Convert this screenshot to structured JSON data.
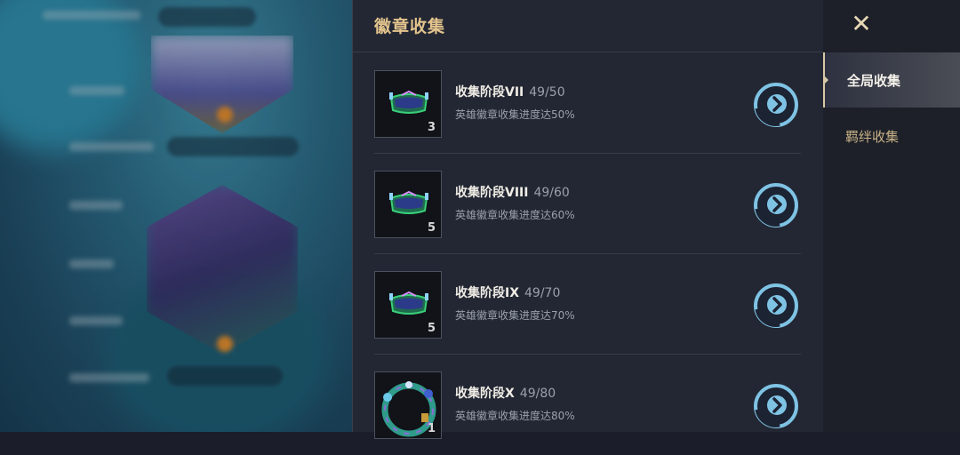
{
  "panel": {
    "title": "徽章收集",
    "items": [
      {
        "name": "收集阶段VII",
        "progress": "49/50",
        "desc": "英雄徽章收集进度达50%",
        "count": "3",
        "icon": "badge-band-icon"
      },
      {
        "name": "收集阶段VIII",
        "progress": "49/60",
        "desc": "英雄徽章收集进度达60%",
        "count": "5",
        "icon": "badge-band-icon"
      },
      {
        "name": "收集阶段IX",
        "progress": "49/70",
        "desc": "英雄徽章收集进度达70%",
        "count": "5",
        "icon": "badge-band-icon"
      },
      {
        "name": "收集阶段X",
        "progress": "49/80",
        "desc": "英雄徽章收集进度达80%",
        "count": "1",
        "icon": "badge-ring-icon"
      }
    ]
  },
  "nav": {
    "close_icon": "close-icon",
    "items": [
      {
        "label": "全局收集",
        "active": true
      },
      {
        "label": "羁绊收集",
        "active": false
      }
    ]
  },
  "colors": {
    "accent_gold": "#e3c48d",
    "panel_bg": "#232733",
    "nav_bg": "#1d2029",
    "button_blue": "#7fc3e4"
  }
}
